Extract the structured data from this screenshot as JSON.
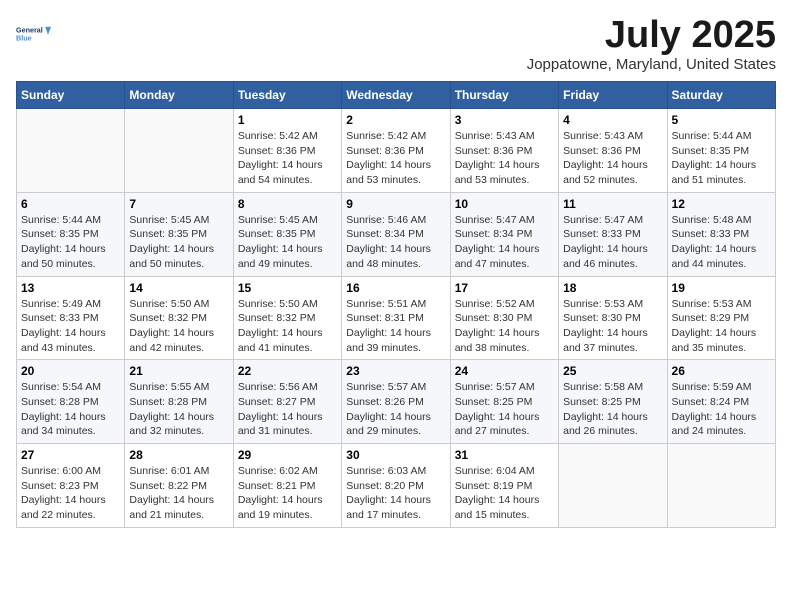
{
  "header": {
    "logo_line1": "General",
    "logo_line2": "Blue",
    "month_title": "July 2025",
    "location": "Joppatowne, Maryland, United States"
  },
  "days_of_week": [
    "Sunday",
    "Monday",
    "Tuesday",
    "Wednesday",
    "Thursday",
    "Friday",
    "Saturday"
  ],
  "weeks": [
    [
      {
        "day": "",
        "info": ""
      },
      {
        "day": "",
        "info": ""
      },
      {
        "day": "1",
        "info": "Sunrise: 5:42 AM\nSunset: 8:36 PM\nDaylight: 14 hours and 54 minutes."
      },
      {
        "day": "2",
        "info": "Sunrise: 5:42 AM\nSunset: 8:36 PM\nDaylight: 14 hours and 53 minutes."
      },
      {
        "day": "3",
        "info": "Sunrise: 5:43 AM\nSunset: 8:36 PM\nDaylight: 14 hours and 53 minutes."
      },
      {
        "day": "4",
        "info": "Sunrise: 5:43 AM\nSunset: 8:36 PM\nDaylight: 14 hours and 52 minutes."
      },
      {
        "day": "5",
        "info": "Sunrise: 5:44 AM\nSunset: 8:35 PM\nDaylight: 14 hours and 51 minutes."
      }
    ],
    [
      {
        "day": "6",
        "info": "Sunrise: 5:44 AM\nSunset: 8:35 PM\nDaylight: 14 hours and 50 minutes."
      },
      {
        "day": "7",
        "info": "Sunrise: 5:45 AM\nSunset: 8:35 PM\nDaylight: 14 hours and 50 minutes."
      },
      {
        "day": "8",
        "info": "Sunrise: 5:45 AM\nSunset: 8:35 PM\nDaylight: 14 hours and 49 minutes."
      },
      {
        "day": "9",
        "info": "Sunrise: 5:46 AM\nSunset: 8:34 PM\nDaylight: 14 hours and 48 minutes."
      },
      {
        "day": "10",
        "info": "Sunrise: 5:47 AM\nSunset: 8:34 PM\nDaylight: 14 hours and 47 minutes."
      },
      {
        "day": "11",
        "info": "Sunrise: 5:47 AM\nSunset: 8:33 PM\nDaylight: 14 hours and 46 minutes."
      },
      {
        "day": "12",
        "info": "Sunrise: 5:48 AM\nSunset: 8:33 PM\nDaylight: 14 hours and 44 minutes."
      }
    ],
    [
      {
        "day": "13",
        "info": "Sunrise: 5:49 AM\nSunset: 8:33 PM\nDaylight: 14 hours and 43 minutes."
      },
      {
        "day": "14",
        "info": "Sunrise: 5:50 AM\nSunset: 8:32 PM\nDaylight: 14 hours and 42 minutes."
      },
      {
        "day": "15",
        "info": "Sunrise: 5:50 AM\nSunset: 8:32 PM\nDaylight: 14 hours and 41 minutes."
      },
      {
        "day": "16",
        "info": "Sunrise: 5:51 AM\nSunset: 8:31 PM\nDaylight: 14 hours and 39 minutes."
      },
      {
        "day": "17",
        "info": "Sunrise: 5:52 AM\nSunset: 8:30 PM\nDaylight: 14 hours and 38 minutes."
      },
      {
        "day": "18",
        "info": "Sunrise: 5:53 AM\nSunset: 8:30 PM\nDaylight: 14 hours and 37 minutes."
      },
      {
        "day": "19",
        "info": "Sunrise: 5:53 AM\nSunset: 8:29 PM\nDaylight: 14 hours and 35 minutes."
      }
    ],
    [
      {
        "day": "20",
        "info": "Sunrise: 5:54 AM\nSunset: 8:28 PM\nDaylight: 14 hours and 34 minutes."
      },
      {
        "day": "21",
        "info": "Sunrise: 5:55 AM\nSunset: 8:28 PM\nDaylight: 14 hours and 32 minutes."
      },
      {
        "day": "22",
        "info": "Sunrise: 5:56 AM\nSunset: 8:27 PM\nDaylight: 14 hours and 31 minutes."
      },
      {
        "day": "23",
        "info": "Sunrise: 5:57 AM\nSunset: 8:26 PM\nDaylight: 14 hours and 29 minutes."
      },
      {
        "day": "24",
        "info": "Sunrise: 5:57 AM\nSunset: 8:25 PM\nDaylight: 14 hours and 27 minutes."
      },
      {
        "day": "25",
        "info": "Sunrise: 5:58 AM\nSunset: 8:25 PM\nDaylight: 14 hours and 26 minutes."
      },
      {
        "day": "26",
        "info": "Sunrise: 5:59 AM\nSunset: 8:24 PM\nDaylight: 14 hours and 24 minutes."
      }
    ],
    [
      {
        "day": "27",
        "info": "Sunrise: 6:00 AM\nSunset: 8:23 PM\nDaylight: 14 hours and 22 minutes."
      },
      {
        "day": "28",
        "info": "Sunrise: 6:01 AM\nSunset: 8:22 PM\nDaylight: 14 hours and 21 minutes."
      },
      {
        "day": "29",
        "info": "Sunrise: 6:02 AM\nSunset: 8:21 PM\nDaylight: 14 hours and 19 minutes."
      },
      {
        "day": "30",
        "info": "Sunrise: 6:03 AM\nSunset: 8:20 PM\nDaylight: 14 hours and 17 minutes."
      },
      {
        "day": "31",
        "info": "Sunrise: 6:04 AM\nSunset: 8:19 PM\nDaylight: 14 hours and 15 minutes."
      },
      {
        "day": "",
        "info": ""
      },
      {
        "day": "",
        "info": ""
      }
    ]
  ]
}
